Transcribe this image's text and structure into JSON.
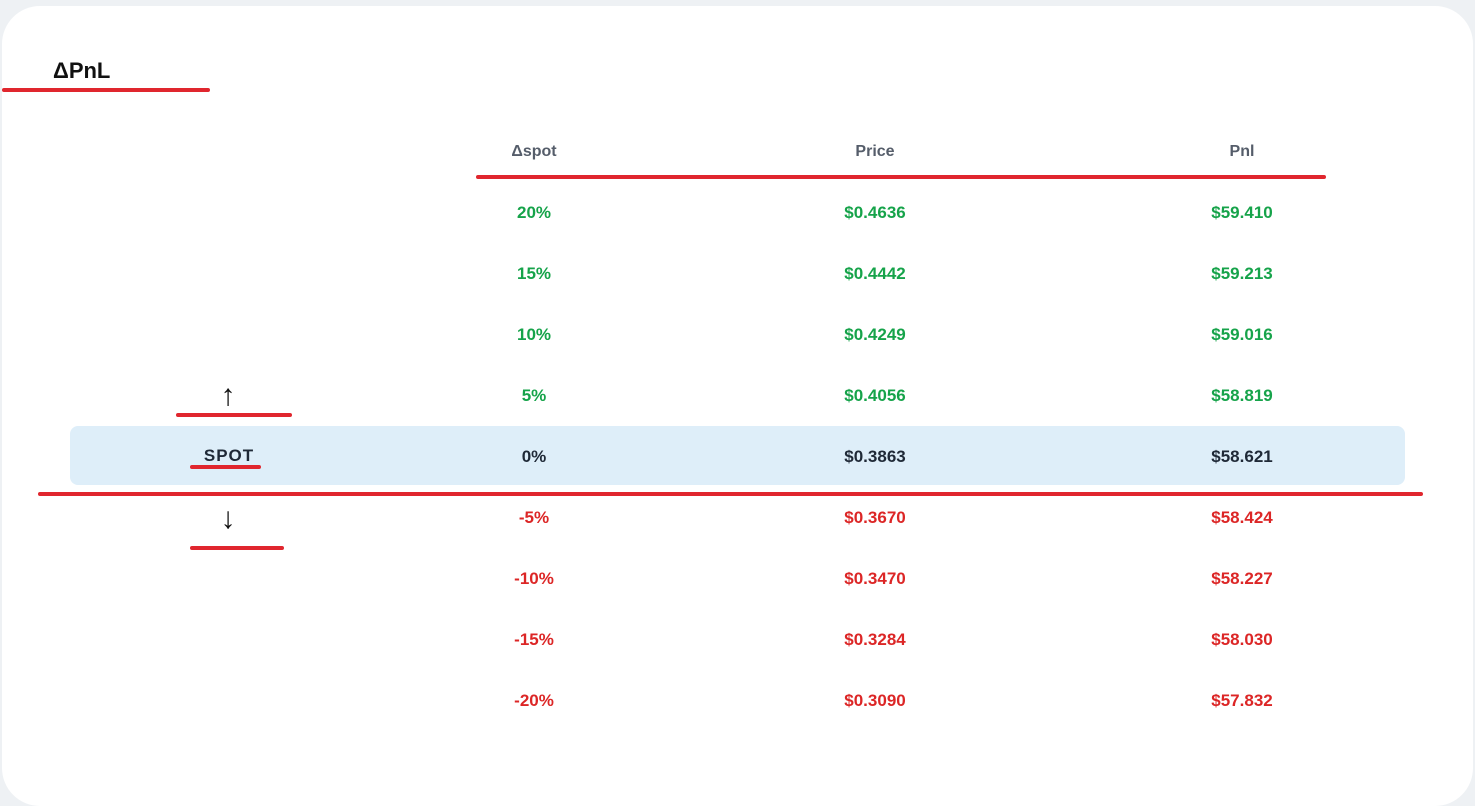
{
  "title": "ΔPnL",
  "columns": {
    "spot": "Δspot",
    "price": "Price",
    "pnl": "Pnl"
  },
  "spot_label": "SPOT",
  "arrows": {
    "up": "↑",
    "down": "↓"
  },
  "rows": [
    {
      "spot": "20%",
      "price": "$0.4636",
      "pnl": "$59.410",
      "trend": "up"
    },
    {
      "spot": "15%",
      "price": "$0.4442",
      "pnl": "$59.213",
      "trend": "up"
    },
    {
      "spot": "10%",
      "price": "$0.4249",
      "pnl": "$59.016",
      "trend": "up"
    },
    {
      "spot": "5%",
      "price": "$0.4056",
      "pnl": "$58.819",
      "trend": "up"
    },
    {
      "spot": "0%",
      "price": "$0.3863",
      "pnl": "$58.621",
      "trend": "flat"
    },
    {
      "spot": "-5%",
      "price": "$0.3670",
      "pnl": "$58.424",
      "trend": "down"
    },
    {
      "spot": "-10%",
      "price": "$0.3470",
      "pnl": "$58.227",
      "trend": "down"
    },
    {
      "spot": "-15%",
      "price": "$0.3284",
      "pnl": "$58.030",
      "trend": "down"
    },
    {
      "spot": "-20%",
      "price": "$0.3090",
      "pnl": "$57.832",
      "trend": "down"
    }
  ],
  "colors": {
    "up": "#16a34a",
    "flat": "#1f2937",
    "down": "#dc2626",
    "highlight": "#deeef9",
    "annotation": "#e0262e"
  }
}
